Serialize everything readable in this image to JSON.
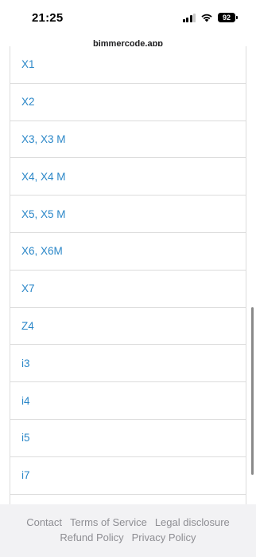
{
  "status_bar": {
    "time": "21:25",
    "battery": "92",
    "icons": [
      "cellular-signal-icon",
      "wifi-icon",
      "battery-icon"
    ]
  },
  "browser": {
    "url": "bimmercode.app"
  },
  "models": [
    {
      "label": "X1"
    },
    {
      "label": "X2"
    },
    {
      "label": "X3, X3 M"
    },
    {
      "label": "X4, X4 M"
    },
    {
      "label": "X5, X5 M"
    },
    {
      "label": "X6, X6M"
    },
    {
      "label": "X7"
    },
    {
      "label": "Z4"
    },
    {
      "label": "i3"
    },
    {
      "label": "i4"
    },
    {
      "label": "i5"
    },
    {
      "label": "i7"
    },
    {
      "label": ""
    }
  ],
  "footer": {
    "contact": "Contact",
    "terms": "Terms of Service",
    "legal": "Legal disclosure",
    "refund": "Refund Policy",
    "privacy": "Privacy Policy"
  },
  "colors": {
    "link": "#2b87c8",
    "divider": "#dcdcdc",
    "footer_bg": "#f2f2f4",
    "footer_text": "#8e8e93"
  }
}
